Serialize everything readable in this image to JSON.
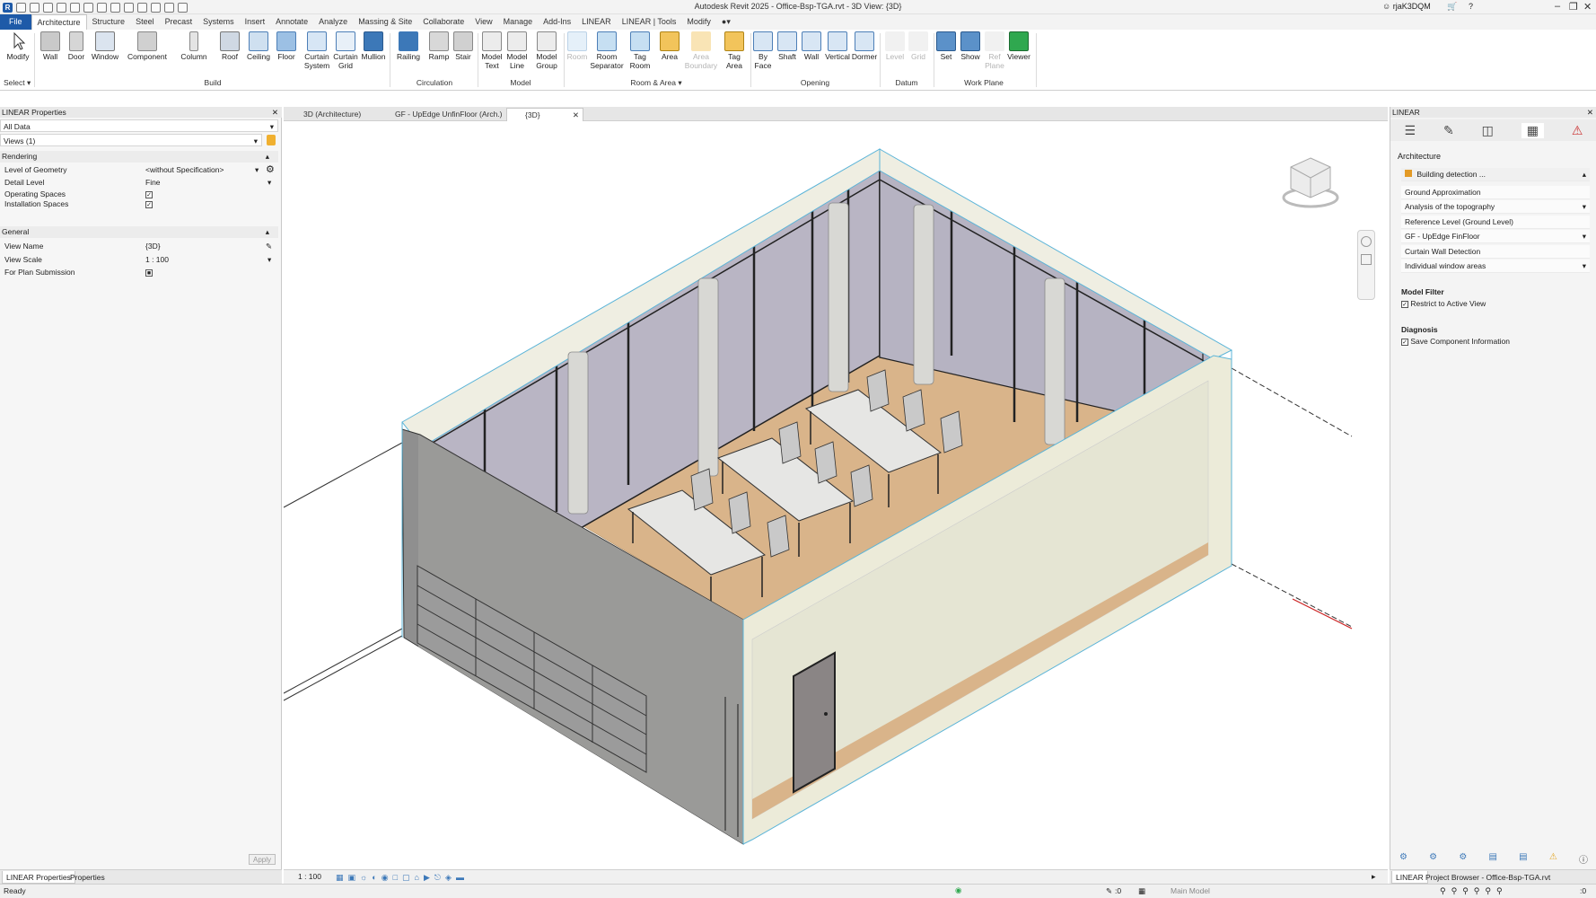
{
  "window": {
    "title": "Autodesk Revit 2025 - Office-Bsp-TGA.rvt - 3D View: {3D}",
    "user": "rjaK3DQM"
  },
  "ribbon_tabs": [
    "File",
    "Architecture",
    "Structure",
    "Steel",
    "Precast",
    "Systems",
    "Insert",
    "Annotate",
    "Analyze",
    "Massing & Site",
    "Collaborate",
    "View",
    "Manage",
    "Add-Ins",
    "LINEAR",
    "LINEAR | Tools",
    "Modify"
  ],
  "active_tab": "Architecture",
  "ribbon": {
    "select_label": "Select",
    "build": {
      "label": "Build",
      "buttons": [
        "Modify",
        "Wall",
        "Door",
        "Window",
        "Component",
        "Column",
        "Roof",
        "Ceiling",
        "Floor",
        "Curtain System",
        "Curtain Grid",
        "Mullion"
      ]
    },
    "circulation": {
      "label": "Circulation",
      "buttons": [
        "Railing",
        "Ramp",
        "Stair"
      ]
    },
    "model": {
      "label": "Model",
      "buttons": [
        "Model Text",
        "Model Line",
        "Model Group"
      ]
    },
    "room_area": {
      "label": "Room & Area",
      "buttons": [
        "Room",
        "Room Separator",
        "Tag Room",
        "Area",
        "Area Boundary",
        "Tag Area"
      ]
    },
    "opening": {
      "label": "Opening",
      "buttons": [
        "By Face",
        "Shaft",
        "Wall",
        "Vertical",
        "Dormer"
      ]
    },
    "datum": {
      "label": "Datum",
      "buttons": [
        "Level",
        "Grid"
      ]
    },
    "work_plane": {
      "label": "Work Plane",
      "buttons": [
        "Set",
        "Show",
        "Ref Plane",
        "Viewer"
      ]
    }
  },
  "properties_panel": {
    "title": "LINEAR Properties",
    "filter": "All Data",
    "views": "Views (1)",
    "rendering_header": "Rendering",
    "rows": [
      {
        "label": "Level of Geometry",
        "value": "<without Specification>"
      },
      {
        "label": "Detail Level",
        "value": "Fine"
      },
      {
        "label": "Operating Spaces",
        "value": "✓"
      },
      {
        "label": "Installation Spaces",
        "value": "✓"
      }
    ],
    "general_header": "General",
    "general_rows": [
      {
        "label": "View Name",
        "value": "{3D}"
      },
      {
        "label": "View Scale",
        "value": "1 : 100"
      },
      {
        "label": "For Plan Submission",
        "value": "■"
      }
    ],
    "apply_label": "Apply",
    "bottom_tabs": [
      "LINEAR Properties",
      "Properties"
    ]
  },
  "doc_tabs": [
    "3D (Architecture)",
    "GF - UpEdge UnfinFloor (Arch.)",
    "{3D}"
  ],
  "right_panel": {
    "title": "LINEAR",
    "section": "Architecture",
    "items": [
      "Building detection ...",
      "Ground Approximation",
      "Analysis of the topography",
      "Reference Level (Ground Level)",
      "GF - UpEdge FinFloor",
      "Curtain Wall Detection",
      "Individual window areas"
    ],
    "model_filter_header": "Model Filter",
    "restrict_label": "Restrict to Active View",
    "diagnosis_header": "Diagnosis",
    "save_info_label": "Save Component Information",
    "bottom_tabs": [
      "LINEAR",
      "Project Browser - Office-Bsp-TGA.rvt"
    ]
  },
  "view_bar": {
    "scale": "1 : 100"
  },
  "status": {
    "text": "Ready",
    "coord": ":0",
    "model": "Main Model",
    "filter_count": ":0"
  },
  "colors": {
    "file_tab": "#1e5aa8",
    "floor_wood": "#d9b48a",
    "concrete": "#8f8f8f",
    "wall_cream": "#ecebd9",
    "glass": "#b9b5c4"
  }
}
